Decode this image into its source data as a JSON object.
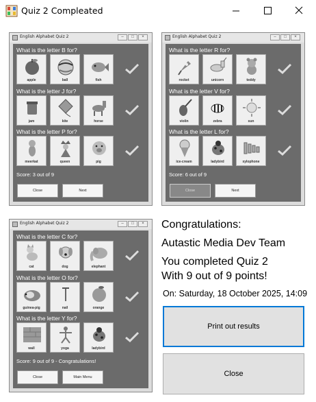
{
  "window": {
    "title": "Quiz 2 Compleated",
    "controls": [
      "minimize",
      "maximize",
      "close"
    ]
  },
  "mini_window_title": "English Alphabet Quiz 2",
  "panels": [
    {
      "questions": [
        {
          "text": "What is the letter B for?",
          "options": [
            {
              "label": "apple",
              "icon": "apple-icon"
            },
            {
              "label": "ball",
              "icon": "ball-icon"
            },
            {
              "label": "fish",
              "icon": "fish-icon"
            }
          ]
        },
        {
          "text": "What is the letter J for?",
          "options": [
            {
              "label": "jam",
              "icon": "jam-icon"
            },
            {
              "label": "kite",
              "icon": "kite-icon"
            },
            {
              "label": "horse",
              "icon": "horse-icon"
            }
          ]
        },
        {
          "text": "What is the letter P for?",
          "options": [
            {
              "label": "meerkat",
              "icon": "meerkat-icon"
            },
            {
              "label": "queen",
              "icon": "queen-icon"
            },
            {
              "label": "pig",
              "icon": "pig-icon"
            }
          ]
        }
      ],
      "score": "Score: 3 out of 9",
      "buttons": [
        "Close",
        "Next"
      ]
    },
    {
      "questions": [
        {
          "text": "What is the letter R for?",
          "options": [
            {
              "label": "rocket",
              "icon": "rocket-icon"
            },
            {
              "label": "unicorn",
              "icon": "unicorn-icon"
            },
            {
              "label": "teddy",
              "icon": "teddy-icon"
            }
          ]
        },
        {
          "text": "What is the letter V for?",
          "options": [
            {
              "label": "violin",
              "icon": "violin-icon"
            },
            {
              "label": "zebra",
              "icon": "zebra-icon"
            },
            {
              "label": "sun",
              "icon": "sun-icon"
            }
          ]
        },
        {
          "text": "What is the letter L for?",
          "options": [
            {
              "label": "ice-cream",
              "icon": "ice-cream-icon"
            },
            {
              "label": "ladybird",
              "icon": "ladybird-icon"
            },
            {
              "label": "xylophone",
              "icon": "xylophone-icon"
            }
          ]
        }
      ],
      "score": "Score: 6 out of 9",
      "buttons": [
        "Close",
        "Next"
      ]
    },
    {
      "questions": [
        {
          "text": "What is the letter C for?",
          "options": [
            {
              "label": "cat",
              "icon": "cat-icon"
            },
            {
              "label": "dog",
              "icon": "dog-icon"
            },
            {
              "label": "elephant",
              "icon": "elephant-icon"
            }
          ]
        },
        {
          "text": "What is the letter O for?",
          "options": [
            {
              "label": "guinea-pig",
              "icon": "guinea-pig-icon"
            },
            {
              "label": "nail",
              "icon": "nail-icon"
            },
            {
              "label": "orange",
              "icon": "orange-icon"
            }
          ]
        },
        {
          "text": "What is the letter Y for?",
          "options": [
            {
              "label": "wall",
              "icon": "wall-icon"
            },
            {
              "label": "yoga",
              "icon": "yoga-icon"
            },
            {
              "label": "ladybird",
              "icon": "ladybird-icon"
            }
          ]
        }
      ],
      "score": "Score: 9 out of 9 - Congratulations!",
      "buttons": [
        "Close",
        "Main Menu"
      ]
    }
  ],
  "messages": {
    "congrats": "Congratulations:",
    "team": "Autastic Media Dev Team",
    "completed": "You completed Quiz 2",
    "points": "With 9 out of 9 points!",
    "date": "On: Saturday, 18 October 2025, 14:09"
  },
  "buttons": {
    "print": "Print out results",
    "close": "Close"
  },
  "colors": {
    "panel_bg": "#6b6b6b",
    "focus_border": "#0078d7",
    "button_bg": "#e1e1e1"
  }
}
